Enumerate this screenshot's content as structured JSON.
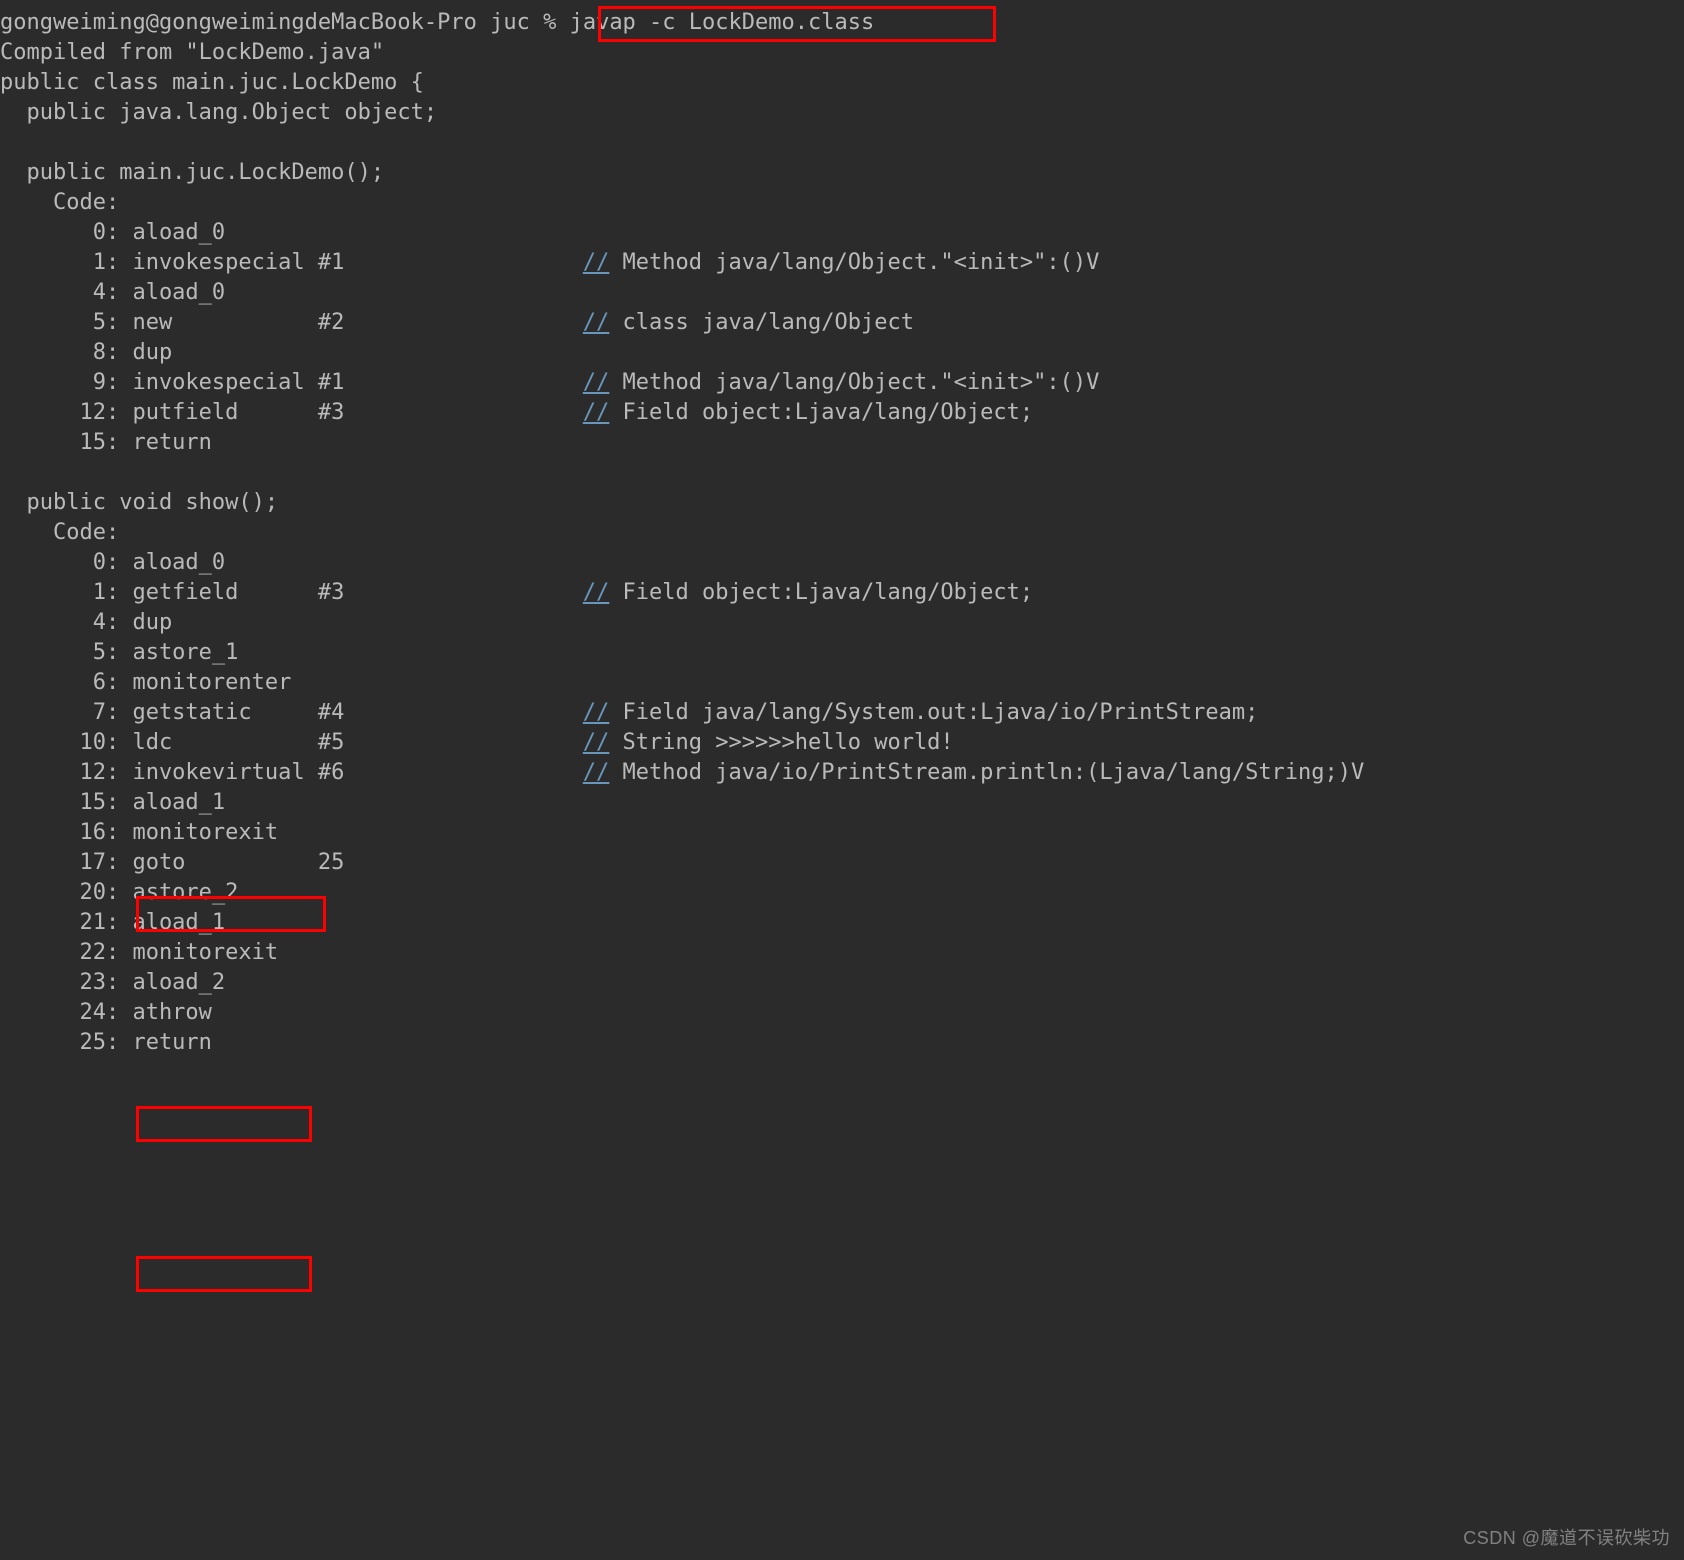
{
  "prompt_user": "gongweiming@gongweimingdeMacBook-Pro",
  "prompt_dir": "juc",
  "prompt_sep": "%",
  "command": "javap -c LockDemo.class",
  "compiled_from": "Compiled from \"LockDemo.java\"",
  "class_decl": "public class main.juc.LockDemo {",
  "field_decl": "  public java.lang.Object object;",
  "ctor_sig": "  public main.juc.LockDemo();",
  "code_label": "    Code:",
  "ctor": {
    "l0": "       0: aload_0",
    "l1": "       1: invokespecial #1",
    "c1": "Method java/lang/Object.\"<init>\":()V",
    "l2": "       4: aload_0",
    "l3": "       5: new           #2",
    "c3": "class java/lang/Object",
    "l4": "       8: dup",
    "l5": "       9: invokespecial #1",
    "c5": "Method java/lang/Object.\"<init>\":()V",
    "l6": "      12: putfield      #3",
    "c6": "Field object:Ljava/lang/Object;",
    "l7": "      15: return"
  },
  "show_sig": "  public void show();",
  "show": {
    "l0": "       0: aload_0",
    "l1": "       1: getfield      #3",
    "c1": "Field object:Ljava/lang/Object;",
    "l2": "       4: dup",
    "l3": "       5: astore_1",
    "l4": "       6: monitorenter",
    "l5": "       7: getstatic     #4",
    "c5": "Field java/lang/System.out:Ljava/io/PrintStream;",
    "l6": "      10: ldc           #5",
    "c6": "String >>>>>>hello world!",
    "l7": "      12: invokevirtual #6",
    "c7": "Method java/io/PrintStream.println:(Ljava/lang/String;)V",
    "l8": "      15: aload_1",
    "l9": "      16: monitorexit",
    "l10": "      17: goto          25",
    "l11": "      20: astore_2",
    "l12": "      21: aload_1",
    "l13": "      22: monitorexit",
    "l14": "      23: aload_2",
    "l15": "      24: athrow",
    "l16": "      25: return"
  },
  "comment_prefix": "//",
  "watermark": "CSDN @魔道不误砍柴功"
}
